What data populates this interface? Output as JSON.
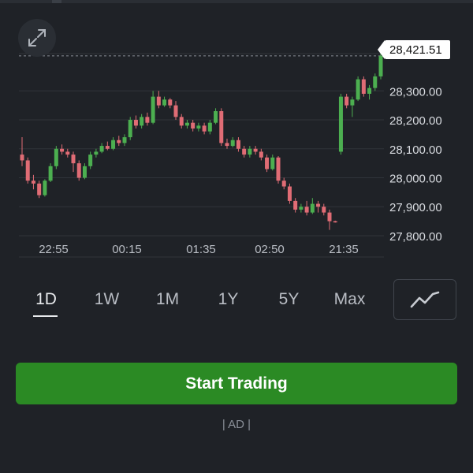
{
  "chart_data": {
    "type": "candlestick",
    "current_price": "28,421.51",
    "y_axis_labels": [
      "28,300.00",
      "28,200.00",
      "28,100.00",
      "28,000.00",
      "27,900.00",
      "27,800.00"
    ],
    "y_ticks": [
      28300,
      28200,
      28100,
      28000,
      27900,
      27800
    ],
    "ylim": [
      27770,
      28445
    ],
    "x_axis_labels": [
      "22:55",
      "00:15",
      "01:35",
      "02:50",
      "21:35"
    ],
    "colors": {
      "up": "#4caf50",
      "down": "#e06c75"
    },
    "candles": [
      [
        28080,
        28060,
        28140,
        28040
      ],
      [
        28060,
        27990,
        28070,
        27980
      ],
      [
        27990,
        27980,
        28010,
        27960
      ],
      [
        27980,
        27940,
        27990,
        27930
      ],
      [
        27940,
        27990,
        27995,
        27935
      ],
      [
        27990,
        28040,
        28050,
        27985
      ],
      [
        28040,
        28100,
        28110,
        28030
      ],
      [
        28100,
        28090,
        28115,
        28080
      ],
      [
        28090,
        28080,
        28100,
        28070
      ],
      [
        28080,
        28050,
        28090,
        28020
      ],
      [
        28050,
        28000,
        28060,
        27990
      ],
      [
        28000,
        28040,
        28050,
        27995
      ],
      [
        28040,
        28080,
        28090,
        28030
      ],
      [
        28080,
        28090,
        28100,
        28070
      ],
      [
        28090,
        28110,
        28120,
        28085
      ],
      [
        28110,
        28100,
        28125,
        28095
      ],
      [
        28100,
        28130,
        28140,
        28095
      ],
      [
        28130,
        28120,
        28145,
        28110
      ],
      [
        28120,
        28140,
        28150,
        28110
      ],
      [
        28140,
        28200,
        28210,
        28130
      ],
      [
        28200,
        28180,
        28215,
        28170
      ],
      [
        28180,
        28210,
        28220,
        28170
      ],
      [
        28210,
        28190,
        28225,
        28180
      ],
      [
        28190,
        28280,
        28300,
        28185
      ],
      [
        28280,
        28250,
        28300,
        28240
      ],
      [
        28250,
        28270,
        28280,
        28245
      ],
      [
        28270,
        28250,
        28275,
        28240
      ],
      [
        28250,
        28210,
        28265,
        28200
      ],
      [
        28210,
        28180,
        28220,
        28170
      ],
      [
        28180,
        28190,
        28200,
        28170
      ],
      [
        28190,
        28170,
        28200,
        28160
      ],
      [
        28170,
        28180,
        28190,
        28160
      ],
      [
        28180,
        28160,
        28190,
        28150
      ],
      [
        28160,
        28190,
        28200,
        28150
      ],
      [
        28190,
        28230,
        28240,
        28185
      ],
      [
        28230,
        28120,
        28240,
        28110
      ],
      [
        28120,
        28110,
        28135,
        28100
      ],
      [
        28110,
        28130,
        28140,
        28105
      ],
      [
        28130,
        28100,
        28140,
        28090
      ],
      [
        28100,
        28080,
        28110,
        28070
      ],
      [
        28080,
        28100,
        28110,
        28070
      ],
      [
        28100,
        28090,
        28110,
        28080
      ],
      [
        28090,
        28070,
        28100,
        28060
      ],
      [
        28070,
        28030,
        28080,
        28020
      ],
      [
        28030,
        28070,
        28080,
        28025
      ],
      [
        28070,
        27990,
        28075,
        27980
      ],
      [
        27990,
        27970,
        28000,
        27960
      ],
      [
        27970,
        27920,
        27980,
        27910
      ],
      [
        27920,
        27890,
        27930,
        27880
      ],
      [
        27890,
        27900,
        27910,
        27880
      ],
      [
        27900,
        27880,
        27920,
        27870
      ],
      [
        27880,
        27910,
        27930,
        27875
      ],
      [
        27910,
        27900,
        27920,
        27880
      ],
      [
        27900,
        27880,
        27910,
        27870
      ],
      [
        27880,
        27850,
        27890,
        27820
      ],
      [
        27850,
        27848,
        27852,
        27845
      ],
      [
        28090,
        28280,
        28290,
        28080
      ],
      [
        28280,
        28250,
        28290,
        28240
      ],
      [
        28250,
        28270,
        28280,
        28210
      ],
      [
        28270,
        28340,
        28350,
        28265
      ],
      [
        28340,
        28290,
        28350,
        28280
      ],
      [
        28290,
        28310,
        28320,
        28270
      ],
      [
        28310,
        28350,
        28360,
        28300
      ],
      [
        28350,
        28421,
        28430,
        28340
      ]
    ]
  },
  "expand_icon": "expand-icon",
  "ranges": [
    "1D",
    "1W",
    "1M",
    "1Y",
    "5Y",
    "Max"
  ],
  "active_range": "1D",
  "chart_type_icon": "line-chart-icon",
  "cta_label": "Start Trading",
  "ad_label": "| AD |"
}
